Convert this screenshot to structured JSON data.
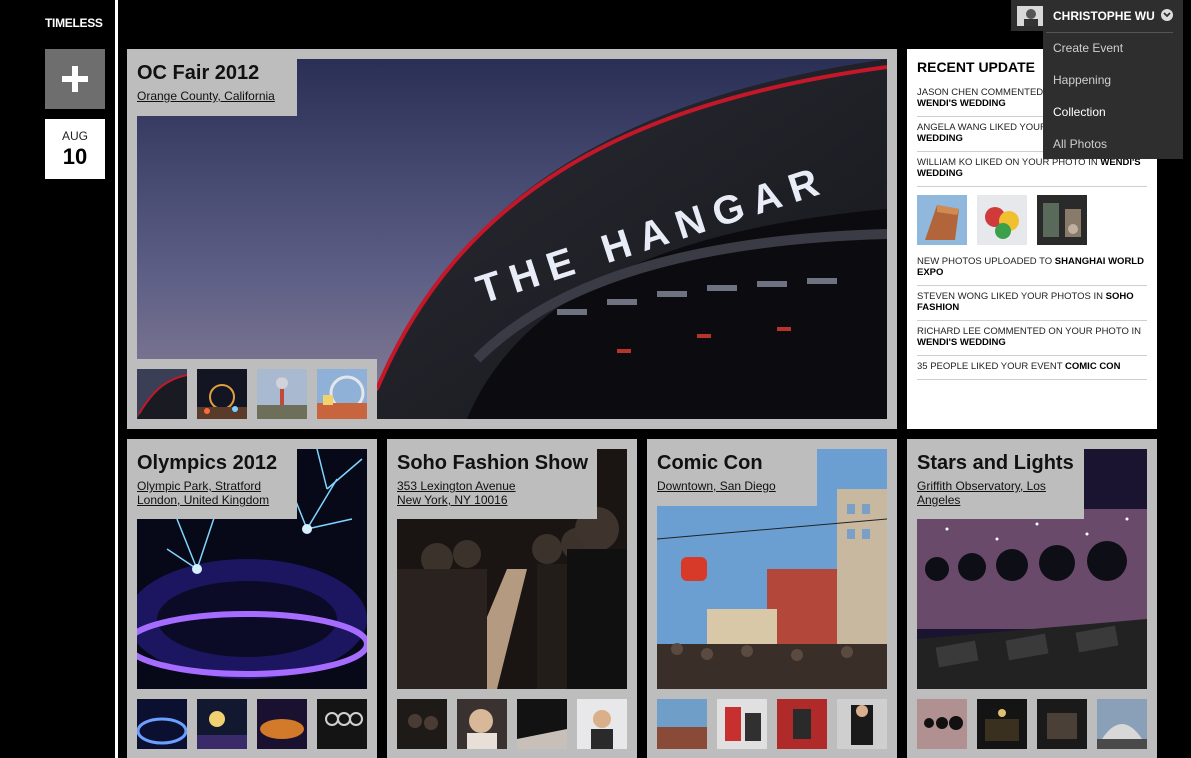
{
  "brand": "TIMELESS",
  "date": {
    "month": "AUG",
    "day": "10"
  },
  "user": {
    "name": "CHRISTOPHE WU",
    "menu": [
      "Create Event",
      "Happening",
      "Collection",
      "All Photos"
    ]
  },
  "featured": {
    "title": "OC Fair 2012",
    "location": "Orange County, California",
    "sign_text": "THE HANGAR"
  },
  "events": [
    {
      "title": "Olympics 2012",
      "location_line1": "Olympic Park, Stratford",
      "location_line2": "London, United Kingdom"
    },
    {
      "title": "Soho Fashion Show",
      "location_line1": "353 Lexington Avenue",
      "location_line2": "New York, NY 10016"
    },
    {
      "title": "Comic Con",
      "location_line1": "Downtown, San Diego",
      "location_line2": ""
    },
    {
      "title": "Stars and Lights",
      "location_line1": "Griffith Observatory, Los",
      "location_line2": "Angeles"
    }
  ],
  "recent": {
    "title": "RECENT UPDATE",
    "updates": [
      {
        "text": "JASON CHEN COMMENTED ON YOUR PHOTO IN ",
        "event": "WENDI'S WEDDING"
      },
      {
        "text": "ANGELA WANG LIKED YOUR PHOTO IN ",
        "event": "WENDI'S WEDDING"
      },
      {
        "text": "WILLIAM KO LIKED ON YOUR PHOTO IN ",
        "event": "WENDI'S WEDDING"
      },
      {
        "text": "NEW PHOTOS UPLOADED TO ",
        "event": "SHANGHAI WORLD EXPO"
      },
      {
        "text": "STEVEN WONG LIKED YOUR PHOTOS IN ",
        "event": "SOHO FASHION"
      },
      {
        "text": "RICHARD LEE COMMENTED ON YOUR PHOTO IN ",
        "event": "WENDI'S WEDDING"
      },
      {
        "text": "35 PEOPLE LIKED YOUR EVENT ",
        "event": "COMIC CON"
      }
    ]
  },
  "colors": {
    "card_bg": "#bdbdbd",
    "menu_bg": "#2e2e2e",
    "rail_divider": "#ffffff"
  }
}
